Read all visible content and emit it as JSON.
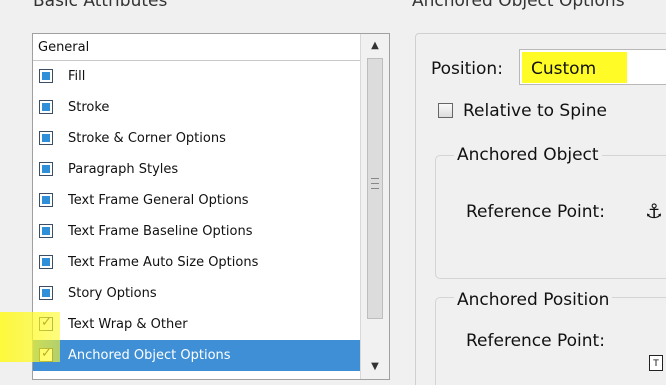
{
  "left_panel": {
    "title": "Basic Attributes",
    "list": {
      "header": "General",
      "items": [
        {
          "label": "Fill",
          "state": "filled"
        },
        {
          "label": "Stroke",
          "state": "filled"
        },
        {
          "label": "Stroke & Corner Options",
          "state": "filled"
        },
        {
          "label": "Paragraph Styles",
          "state": "filled"
        },
        {
          "label": "Text Frame General Options",
          "state": "filled"
        },
        {
          "label": "Text Frame Baseline Options",
          "state": "filled"
        },
        {
          "label": "Text Frame Auto Size Options",
          "state": "filled"
        },
        {
          "label": "Story Options",
          "state": "filled"
        },
        {
          "label": "Text Wrap & Other",
          "state": "checked"
        },
        {
          "label": "Anchored Object Options",
          "state": "checked",
          "selected": true
        }
      ]
    },
    "scroll": {
      "up_icon": "triangle-up-icon",
      "down_icon": "triangle-down-icon",
      "up_glyph": "▲",
      "down_glyph": "▼"
    }
  },
  "right_panel": {
    "title": "Anchored Object Options",
    "position": {
      "label": "Position:",
      "value": "Custom"
    },
    "relative_to_spine": {
      "label": "Relative to Spine",
      "checked": false
    },
    "anchored_object": {
      "title": "Anchored Object",
      "reference_point_label": "Reference Point:",
      "icon": "anchor-icon",
      "icon_glyph": "⚓"
    },
    "anchored_position": {
      "title": "Anchored Position",
      "reference_point_label": "Reference Point:",
      "icon": "reference-point-icon",
      "icon_glyph": "T"
    }
  },
  "colors": {
    "selection": "#3e8fd6",
    "highlight": "#fffa00",
    "icon_fill": "#2f8fd8"
  },
  "check_glyph": "✓"
}
